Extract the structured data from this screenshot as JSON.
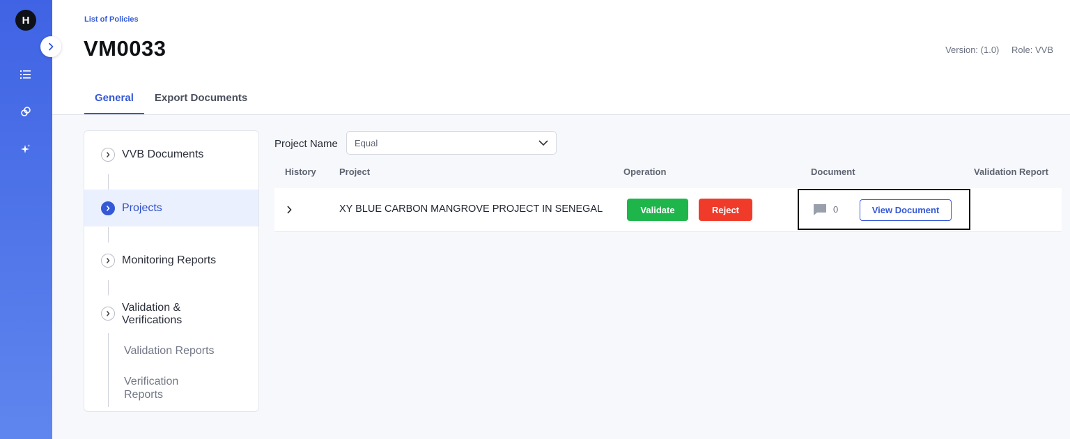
{
  "app": {
    "logo_letter": "H"
  },
  "rail": {
    "icons": [
      "list-icon",
      "link-icon",
      "sparkle-icon"
    ]
  },
  "header": {
    "breadcrumb": "List of Policies",
    "title": "VM0033",
    "version": "Version: (1.0)",
    "role": "Role: VVB"
  },
  "tabs": [
    {
      "label": "General",
      "active": true
    },
    {
      "label": "Export Documents",
      "active": false
    }
  ],
  "tree": {
    "items": [
      {
        "label": "VVB Documents",
        "selected": false
      },
      {
        "label": "Projects",
        "selected": true
      },
      {
        "label": "Monitoring Reports",
        "selected": false
      },
      {
        "label": "Validation &\nVerifications",
        "selected": false
      }
    ],
    "subitems": [
      {
        "label": "Validation Reports"
      },
      {
        "label": "Verification\nReports"
      }
    ]
  },
  "filter": {
    "label": "Project Name",
    "value": "Equal"
  },
  "table": {
    "columns": [
      "History",
      "Project",
      "Operation",
      "Document",
      "Validation Report"
    ],
    "rows": [
      {
        "project": "XY BLUE CARBON MANGROVE PROJECT IN SENEGAL",
        "validate_label": "Validate",
        "reject_label": "Reject",
        "comment_count": "0",
        "view_label": "View Document"
      }
    ]
  },
  "colors": {
    "accent": "#3559d6",
    "validate": "#1eb54b",
    "reject": "#f03b2a",
    "rail_top": "#3f63e4",
    "rail_bottom": "#5f86ee"
  }
}
